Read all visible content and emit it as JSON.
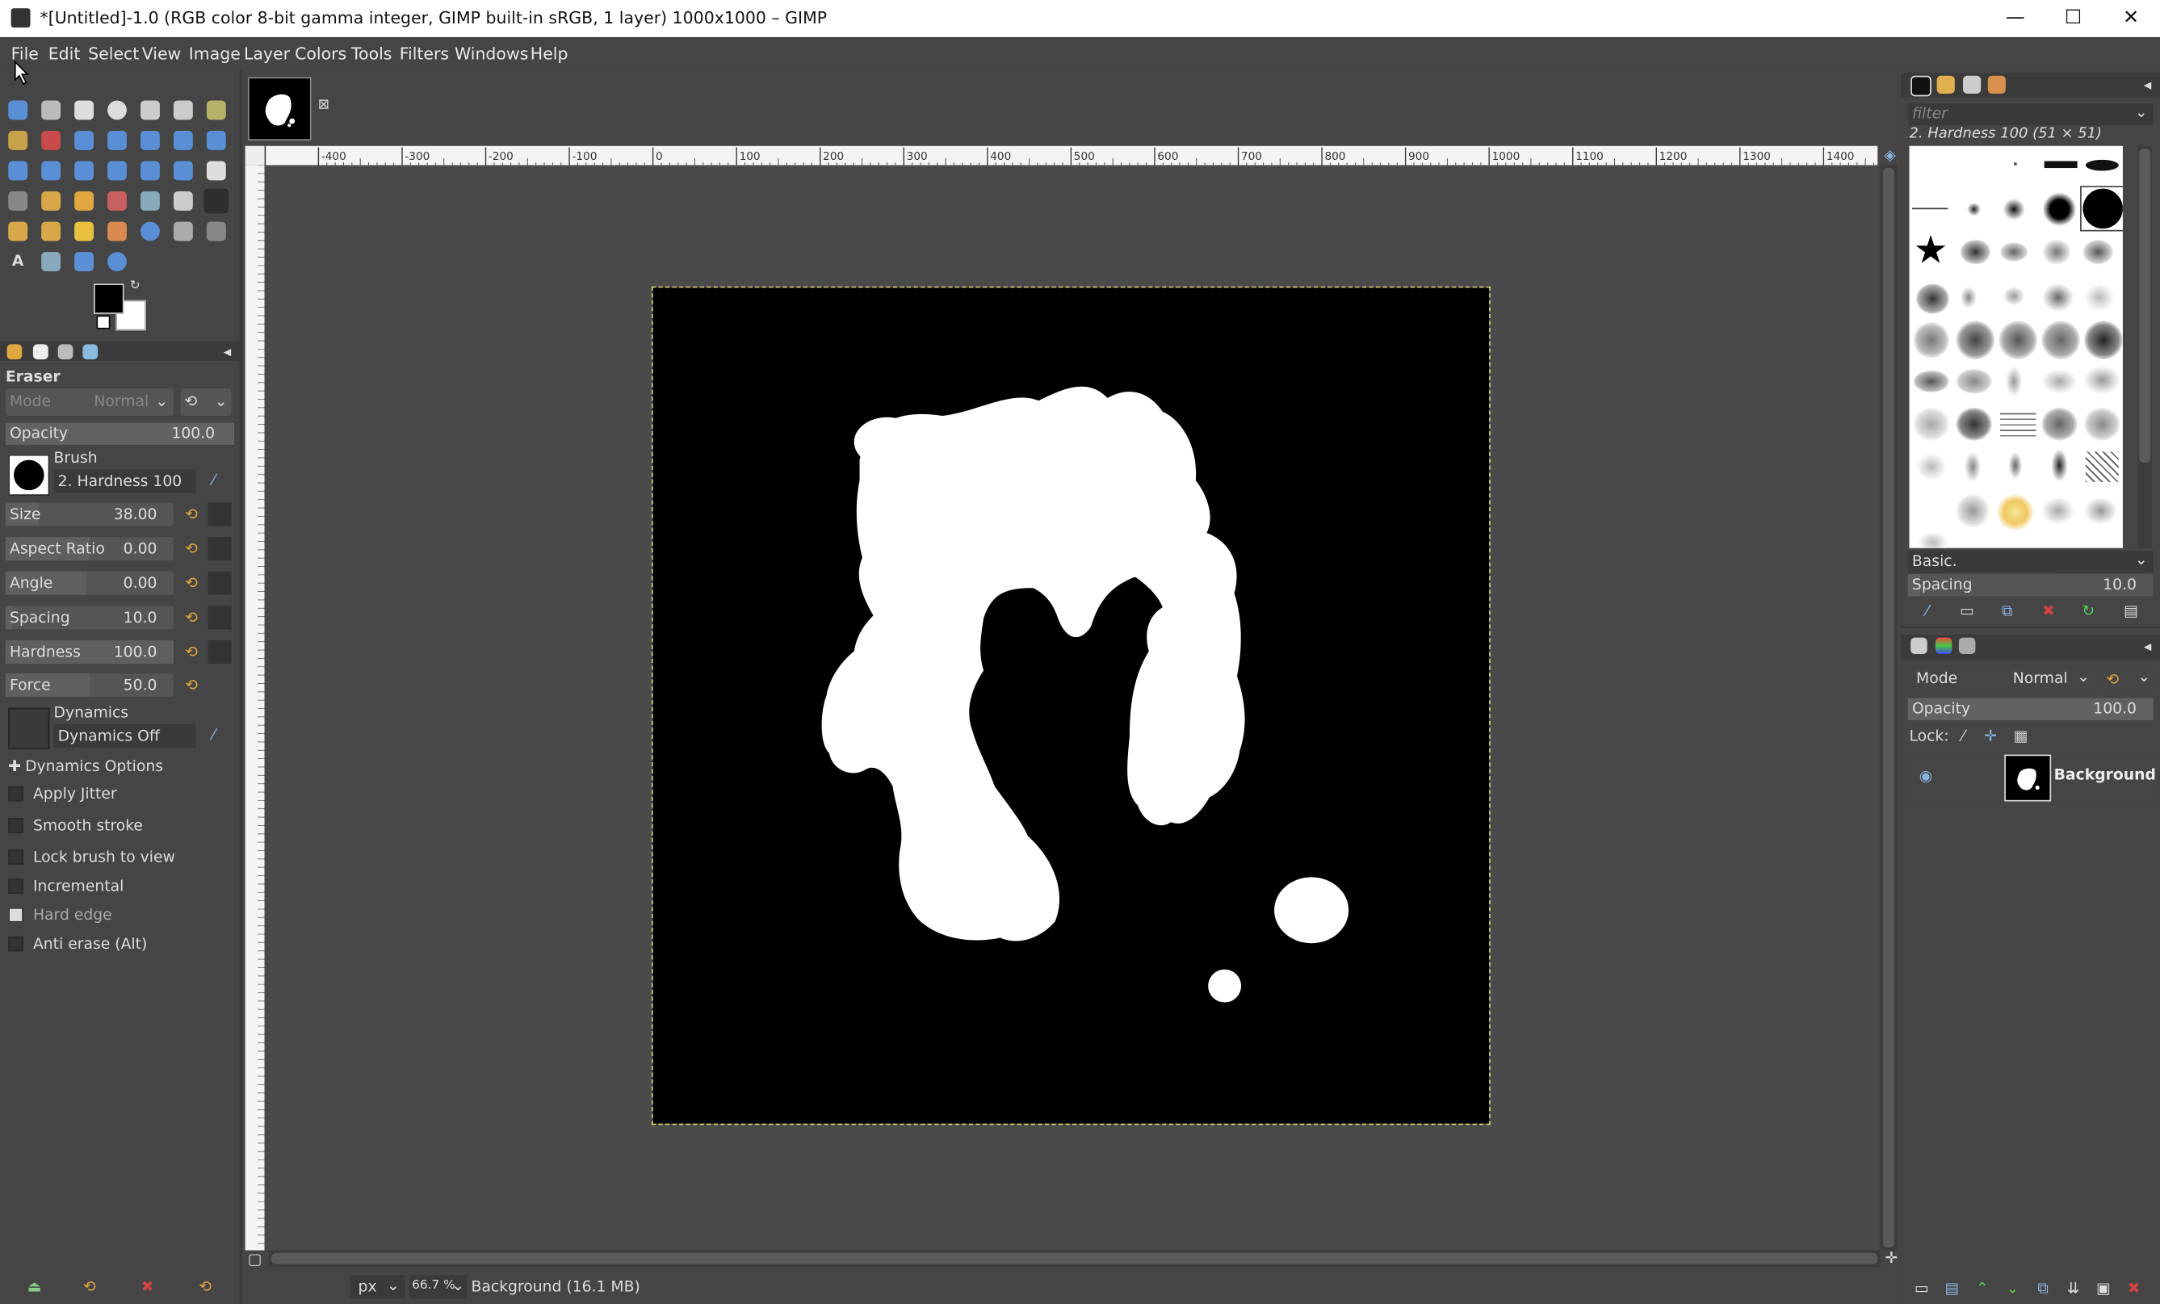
{
  "window": {
    "title": "*[Untitled]-1.0 (RGB color 8-bit gamma integer, GIMP built-in sRGB, 1 layer) 1000x1000 – GIMP",
    "controls": {
      "minimize": "—",
      "maximize": "☐",
      "close": "✕"
    }
  },
  "menu": [
    "File",
    "Edit",
    "Select",
    "View",
    "Image",
    "Layer",
    "Colors",
    "Tools",
    "Filters",
    "Windows",
    "Help"
  ],
  "tool_options": {
    "tool_name": "Eraser",
    "mode_label": "Mode",
    "mode_value": "Normal",
    "opacity": {
      "label": "Opacity",
      "value": "100.0"
    },
    "brush": {
      "label": "Brush",
      "name": "2. Hardness 100"
    },
    "size": {
      "label": "Size",
      "value": "38.00"
    },
    "aspect_ratio": {
      "label": "Aspect Ratio",
      "value": "0.00"
    },
    "angle": {
      "label": "Angle",
      "value": "0.00"
    },
    "spacing": {
      "label": "Spacing",
      "value": "10.0"
    },
    "hardness": {
      "label": "Hardness",
      "value": "100.0"
    },
    "force": {
      "label": "Force",
      "value": "50.0"
    },
    "dynamics": {
      "label": "Dynamics",
      "name": "Dynamics Off"
    },
    "dynamics_options": "Dynamics Options",
    "apply_jitter": "Apply Jitter",
    "smooth_stroke": "Smooth stroke",
    "lock_brush": "Lock brush to view",
    "incremental": "Incremental",
    "hard_edge": "Hard edge",
    "anti_erase": "Anti erase  (Alt)"
  },
  "colors": {
    "foreground": "#000000",
    "background": "#ffffff",
    "accent": "#d4d06a"
  },
  "ruler": {
    "top_labels": [
      "-400",
      "-300",
      "-200",
      "-100",
      "0",
      "100",
      "200",
      "300",
      "400",
      "500",
      "600",
      "700",
      "800",
      "900",
      "1000",
      "1100",
      "1200",
      "1300",
      "1400"
    ]
  },
  "status": {
    "unit": "px",
    "zoom": "66.7 %",
    "layer_info": "Background (16.1 MB)"
  },
  "brushes_panel": {
    "filter_placeholder": "filter",
    "selected_brush": "2. Hardness 100 (51 × 51)",
    "preset": "Basic.",
    "spacing_label": "Spacing",
    "spacing_value": "10.0"
  },
  "layers_panel": {
    "mode_label": "Mode",
    "mode_value": "Normal",
    "opacity_label": "Opacity",
    "opacity_value": "100.0",
    "lock_label": "Lock:",
    "layer_name": "Background"
  }
}
